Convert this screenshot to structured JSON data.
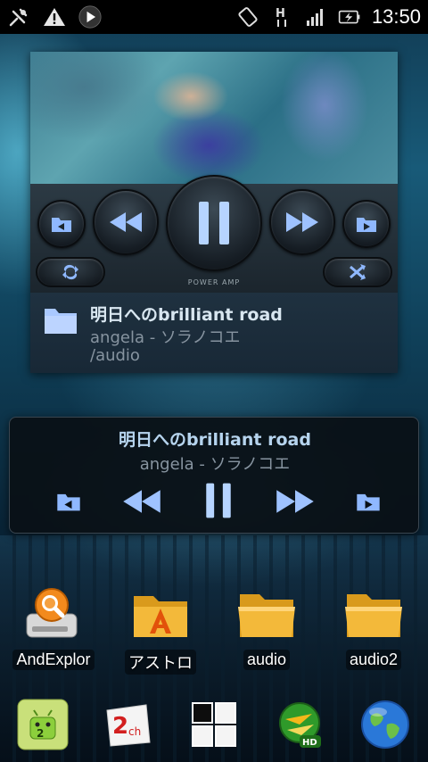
{
  "status_bar": {
    "time": "13:50",
    "left_icons": [
      "usb-debug-icon",
      "warning-icon",
      "play-icon"
    ],
    "right_icons": [
      "screen-rotate-icon",
      "hspa-icon",
      "signal-icon",
      "battery-charging-icon"
    ]
  },
  "power_amp_widget": {
    "brand": "POWER AMP",
    "track_title": "明日へのbrilliant road",
    "track_artist": "angela - ソラノコエ",
    "track_path": "/audio"
  },
  "mini_player_widget": {
    "track_title": "明日へのbrilliant road",
    "track_artist": "angela - ソラノコエ"
  },
  "apps": [
    {
      "label": "AndExplor",
      "icon": "andexplorer-icon"
    },
    {
      "label": "アストロ",
      "icon": "astro-folder-icon"
    },
    {
      "label": "audio",
      "icon": "folder-icon"
    },
    {
      "label": "audio2",
      "icon": "folder-icon"
    }
  ],
  "dock": [
    "2chmate-icon",
    "2ch-icon",
    "app-drawer-icon",
    "go-sms-icon",
    "browser-globe-icon"
  ],
  "colors": {
    "accent": "#8fb8ff",
    "status_bar": "#000000",
    "widget_bg": "#1a2a36"
  }
}
